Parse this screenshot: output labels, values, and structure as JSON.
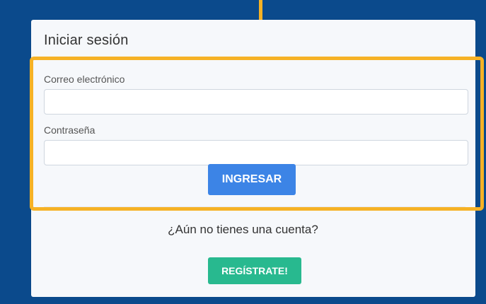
{
  "login": {
    "title": "Iniciar sesión",
    "email_label": "Correo electrónico",
    "email_value": "",
    "email_placeholder": "",
    "password_label": "Contraseña",
    "password_value": "",
    "password_placeholder": "",
    "submit_label": "INGRESAR"
  },
  "register": {
    "prompt": "¿Aún no tienes una cuenta?",
    "button_label": "REGÍSTRATE!"
  },
  "colors": {
    "background_blue": "#0b4a8c",
    "highlight": "#f6b225",
    "primary_button": "#3c84e6",
    "success_button": "#28b98f"
  }
}
